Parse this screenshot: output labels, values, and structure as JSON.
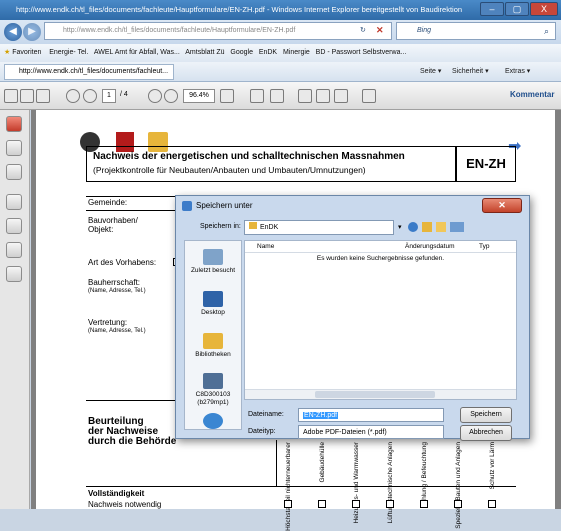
{
  "window": {
    "title": "http://www.endk.ch/tl_files/documents/fachleute/Hauptformulare/EN-ZH.pdf - Windows Internet Explorer bereitgestellt von Baudirektion",
    "minimize": "–",
    "maximize": "▢",
    "close": "X"
  },
  "browser": {
    "address": "http://www.endk.ch/tl_files/documents/fachleute/Hauptformulare/EN-ZH.pdf",
    "search_placeholder": "Bing",
    "favorites_label": "Favoriten",
    "favorites": [
      "Energie- Tel.",
      "AWEL Amt für Abfall, Was...",
      "Amtsblatt Zü",
      "Google",
      "EnDK",
      "Minergie",
      "BD - Passwort Selbstverwa..."
    ],
    "tab_label": "http://www.endk.ch/tl_files/documents/fachleut...",
    "commands": [
      "Seite ▾",
      "Sicherheit ▾",
      "Extras ▾"
    ]
  },
  "pdf_toolbar": {
    "page_current": "1",
    "page_total": "/ 4",
    "zoom": "96.4%",
    "kommentar": "Kommentar"
  },
  "document": {
    "title_line1": "Nachweis der energetischen und schalltechnischen Massnahmen",
    "title_line2": "(Projektkontrolle für Neubauten/Anbauten und Umbauten/Umnutzungen)",
    "code": "EN-ZH",
    "gemeinde": "Gemeinde:",
    "bauvorhaben": "Bauvorhaben/\nObjekt:",
    "art": "Art des Vorhabens:",
    "bauherrschaft": "Bauherrschaft:",
    "bauherrschaft_sub": "(Name, Adresse, Tel.)",
    "vertretung": "Vertretung:",
    "vertretung_sub": "(Name, Adresse, Tel.)",
    "beurteilung": "Beurteilung\nder Nachweise\ndurch die Behörde",
    "columns": [
      "Höchstanteil nichterneuerbarer",
      "Gebäudehülle",
      "Heizungs- und Warmwasser",
      "Lüftungstechnische Anlagen",
      "Kühlung / Befeuchtung",
      "Spezielle Bauten und Anlagen",
      "Schutz vor Lärm"
    ],
    "vollstaendigkeit": "Vollständigkeit",
    "nachweis": "Nachweis notwendig"
  },
  "dialog": {
    "title": "Speichern unter",
    "speichern_in_label": "Speichern in:",
    "folder": "EnDK",
    "places": [
      "Zuletzt besucht",
      "Desktop",
      "Bibliotheken",
      "C8D300103\n(b279mp1)",
      ""
    ],
    "col_name": "Name",
    "col_date": "Änderungsdatum",
    "col_type": "Typ",
    "empty_msg": "Es wurden keine Suchergebnisse gefunden.",
    "filename_label": "Dateiname:",
    "filename": "EN-ZH.pdf",
    "filetype_label": "Dateityp:",
    "filetype": "Adobe PDF-Dateien (*.pdf)",
    "save": "Speichern",
    "cancel": "Abbrechen"
  }
}
